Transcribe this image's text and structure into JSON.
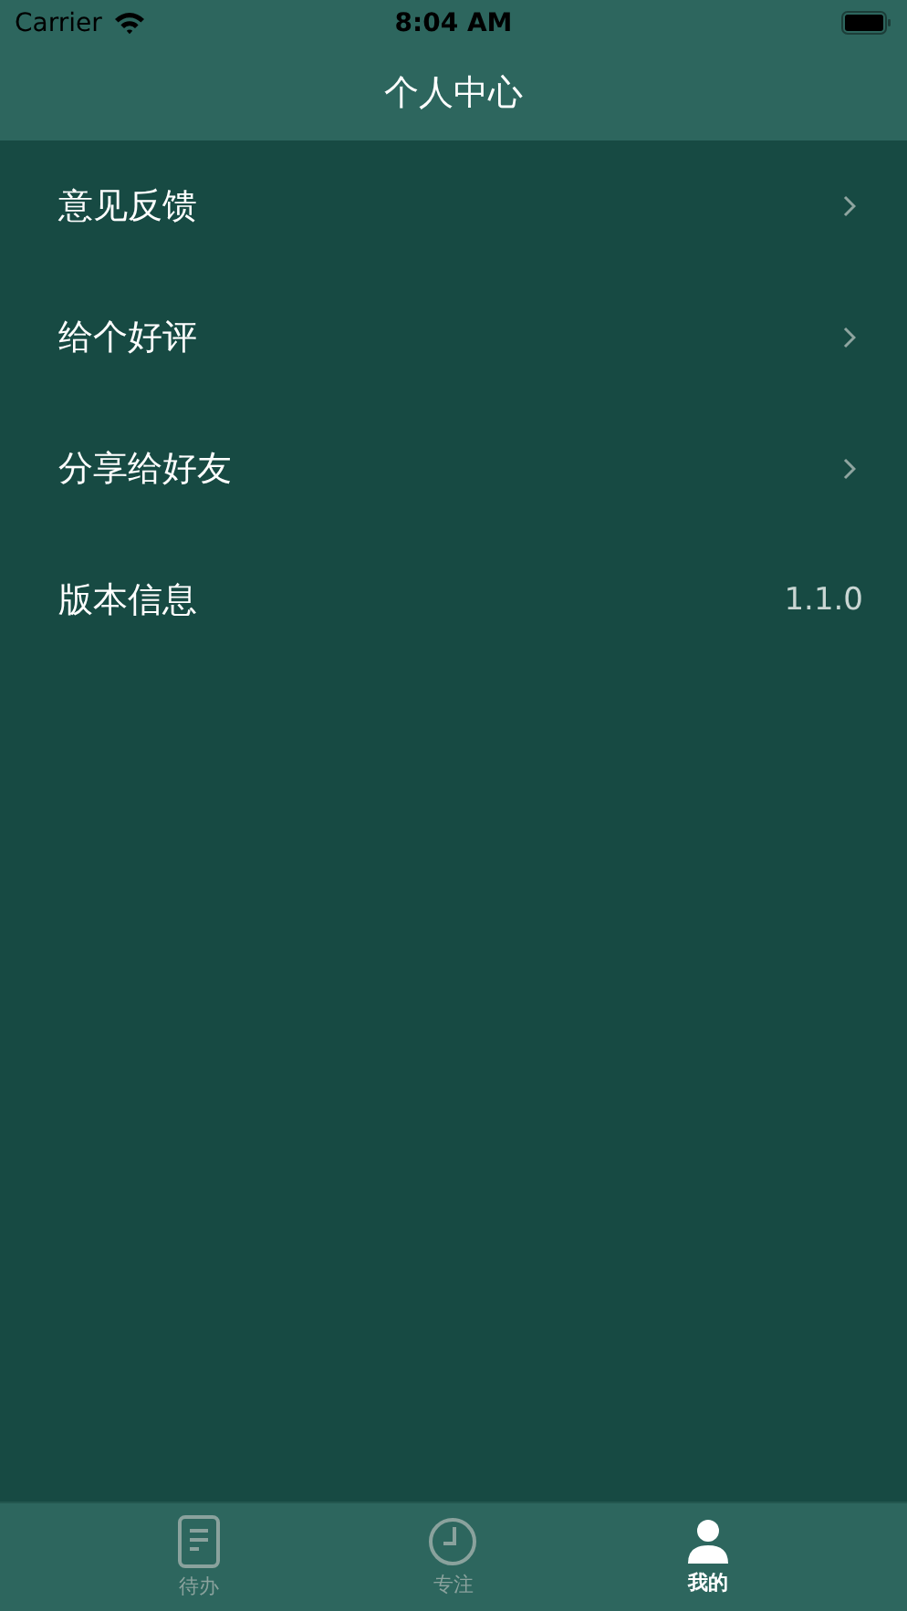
{
  "status_bar": {
    "carrier": "Carrier",
    "time": "8:04 AM"
  },
  "nav": {
    "title": "个人中心"
  },
  "rows": [
    {
      "kind": "link",
      "label": "意见反馈"
    },
    {
      "kind": "link",
      "label": "给个好评"
    },
    {
      "kind": "link",
      "label": "分享给好友"
    },
    {
      "kind": "value",
      "label": "版本信息",
      "value": "1.1.0"
    }
  ],
  "tabs": [
    {
      "kind": "document",
      "label": "待办",
      "selected": false
    },
    {
      "kind": "clock",
      "label": "专注",
      "selected": false
    },
    {
      "kind": "person",
      "label": "我的",
      "selected": true
    }
  ]
}
